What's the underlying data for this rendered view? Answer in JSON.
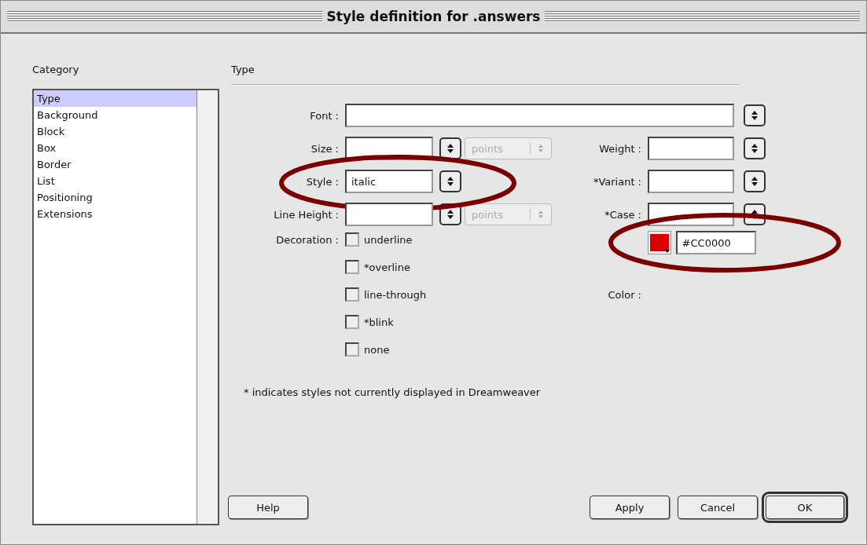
{
  "window": {
    "title": "Style definition for .answers"
  },
  "category": {
    "label": "Category",
    "items": [
      {
        "label": "Type",
        "selected": true
      },
      {
        "label": "Background",
        "selected": false
      },
      {
        "label": "Block",
        "selected": false
      },
      {
        "label": "Box",
        "selected": false
      },
      {
        "label": "Border",
        "selected": false
      },
      {
        "label": "List",
        "selected": false
      },
      {
        "label": "Positioning",
        "selected": false
      },
      {
        "label": "Extensions",
        "selected": false
      }
    ]
  },
  "panel": {
    "title": "Type"
  },
  "font": {
    "label": "Font :"
  },
  "left_fields": [
    {
      "label": "Size :",
      "units": {
        "value": "points",
        "disabled": true
      }
    },
    {
      "label": "Style :",
      "value": "italic",
      "circled": true
    },
    {
      "label": "Line Height :",
      "units": {
        "value": "points",
        "disabled": true
      }
    }
  ],
  "right_fields": [
    {
      "label": "Weight :",
      "kind": "select"
    },
    {
      "label": "*Variant :",
      "kind": "select"
    },
    {
      "label": "*Case :",
      "kind": "select"
    },
    {
      "label": "Color :",
      "kind": "color",
      "color": "#dd0000",
      "value": "#CC0000",
      "circled": true
    }
  ],
  "decoration": {
    "label": "Decoration :",
    "options": [
      {
        "label": "underline",
        "checked": false
      },
      {
        "label": "*overline",
        "checked": false
      },
      {
        "label": "line-through",
        "checked": false
      },
      {
        "label": "*blink",
        "checked": false
      },
      {
        "label": "none",
        "checked": false
      }
    ]
  },
  "note": "* indicates styles not currently displayed in Dreamweaver",
  "buttons": [
    {
      "label": "Help",
      "default": false
    },
    {
      "label": "Apply",
      "default": false
    },
    {
      "label": "Cancel",
      "default": false
    },
    {
      "label": "OK",
      "default": true
    }
  ]
}
